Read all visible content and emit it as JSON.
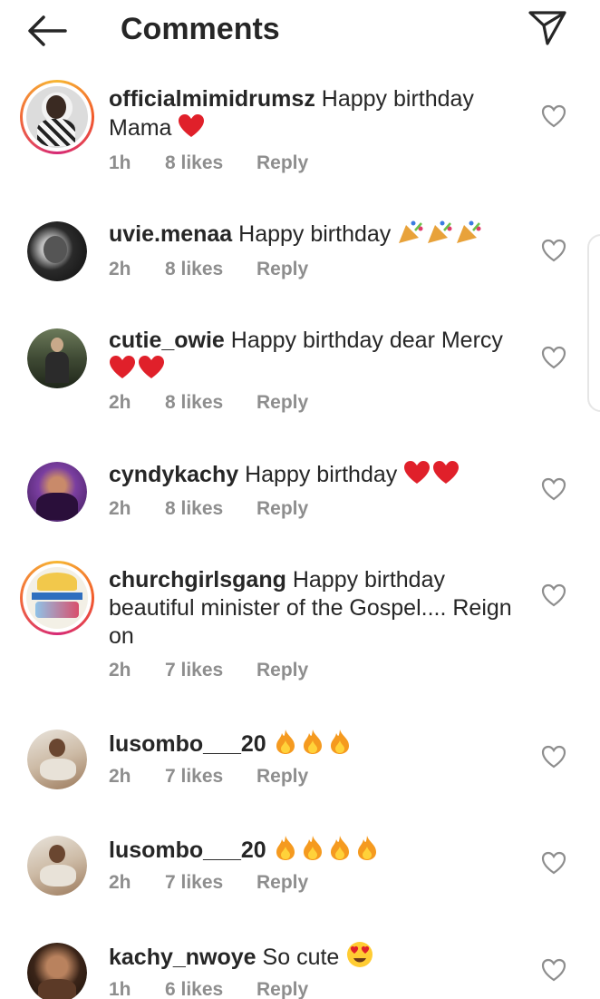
{
  "header": {
    "title": "Comments",
    "back_icon": "back-arrow-icon",
    "send_icon": "send-icon"
  },
  "comments": [
    {
      "username": "officialmimidrumsz",
      "text": "Happy birthday Mama",
      "emoji": [
        "heart"
      ],
      "time": "1h",
      "likes": "8 likes",
      "reply": "Reply",
      "story_ring": true
    },
    {
      "username": "uvie.menaa",
      "text": "Happy birthday",
      "emoji": [
        "party",
        "party",
        "party"
      ],
      "time": "2h",
      "likes": "8 likes",
      "reply": "Reply",
      "story_ring": false
    },
    {
      "username": "cutie_owie",
      "text": "Happy birthday dear Mercy",
      "emoji": [
        "heart",
        "heart"
      ],
      "time": "2h",
      "likes": "8 likes",
      "reply": "Reply",
      "story_ring": false
    },
    {
      "username": "cyndykachy",
      "text": "Happy birthday",
      "emoji": [
        "heart",
        "heart"
      ],
      "time": "2h",
      "likes": "8 likes",
      "reply": "Reply",
      "story_ring": false
    },
    {
      "username": "churchgirlsgang",
      "text": "Happy birthday beautiful minister of the Gospel.... Reign on",
      "emoji": [],
      "time": "2h",
      "likes": "7 likes",
      "reply": "Reply",
      "story_ring": true
    },
    {
      "username": "lusombo___20",
      "text": "",
      "emoji": [
        "fire",
        "fire",
        "fire"
      ],
      "time": "2h",
      "likes": "7 likes",
      "reply": "Reply",
      "story_ring": false
    },
    {
      "username": "lusombo___20",
      "text": "",
      "emoji": [
        "fire",
        "fire",
        "fire",
        "fire"
      ],
      "time": "2h",
      "likes": "7 likes",
      "reply": "Reply",
      "story_ring": false
    },
    {
      "username": "kachy_nwoye",
      "text": "So cute",
      "emoji": [
        "heart-eyes"
      ],
      "time": "1h",
      "likes": "6 likes",
      "reply": "Reply",
      "story_ring": false
    }
  ],
  "colors": {
    "text": "#262626",
    "meta": "#8e8e8e",
    "heart_emoji": "#e0202a",
    "ring_start": "#f7b733",
    "ring_end": "#d62976"
  }
}
